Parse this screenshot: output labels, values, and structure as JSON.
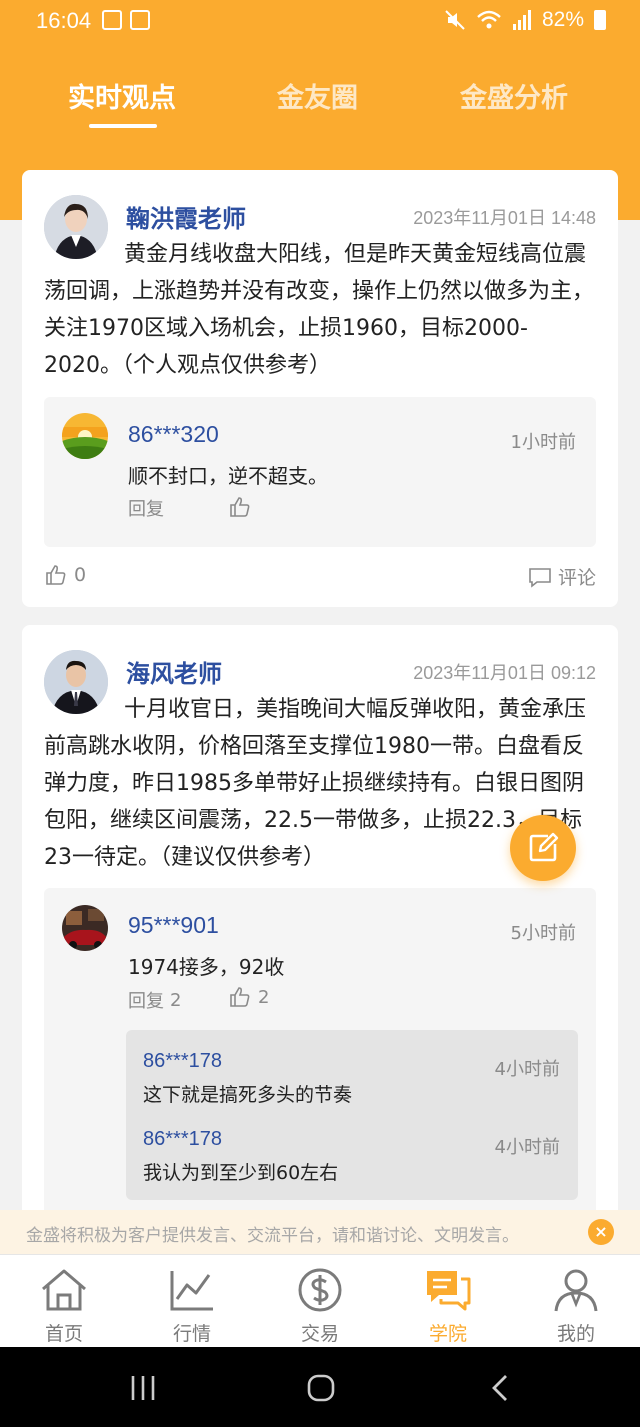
{
  "status_bar": {
    "time": "16:04",
    "battery": "82%"
  },
  "tabs": [
    {
      "label": "实时观点",
      "active": true
    },
    {
      "label": "金友圈",
      "active": false
    },
    {
      "label": "金盛分析",
      "active": false
    }
  ],
  "posts": [
    {
      "teacher": "鞠洪霞老师",
      "date": "2023年11月01日 14:48",
      "text": "黄金月线收盘大阳线，但是昨天黄金短线高位震荡回调，上涨趋势并没有改变，操作上仍然以做多为主，关注1970区域入场机会，止损1960，目标2000-2020。（个人观点仅供参考）",
      "comments": [
        {
          "user": "86***320",
          "time": "1小时前",
          "text": "顺不封口，逆不超支。",
          "reply_label": "回复"
        }
      ],
      "likes": "0",
      "comment_label": "评论"
    },
    {
      "teacher": "海风老师",
      "date": "2023年11月01日 09:12",
      "text": "十月收官日，美指晚间大幅反弹收阳，黄金承压前高跳水收阴，价格回落至支撑位1980一带。白盘看反弹力度，昨日1985多单带好止损继续持有。白银日图阴包阳，继续区间震荡，22.5一带做多，止损22.3，目标23一待定。（建议仅供参考）",
      "comments": [
        {
          "user": "95***901",
          "time": "5小时前",
          "text": "1974接多，92收",
          "reply_label": "回复",
          "reply_count": "2",
          "like_count": "2",
          "replies": [
            {
              "user": "86***178",
              "time": "4小时前",
              "text": "这下就是搞死多头的节奏"
            },
            {
              "user": "86***178",
              "time": "4小时前",
              "text": "我认为到至少到60左右"
            }
          ]
        }
      ]
    }
  ],
  "notice": "金盛将积极为客户提供发言、交流平台，请和谐讨论、文明发言。",
  "bottom_nav": [
    {
      "label": "首页",
      "icon": "home-icon"
    },
    {
      "label": "行情",
      "icon": "chart-icon"
    },
    {
      "label": "交易",
      "icon": "dollar-icon"
    },
    {
      "label": "学院",
      "icon": "chat-icon",
      "active": true
    },
    {
      "label": "我的",
      "icon": "user-icon"
    }
  ],
  "colors": {
    "accent": "#fbab2f",
    "link": "#2d4fa0"
  }
}
